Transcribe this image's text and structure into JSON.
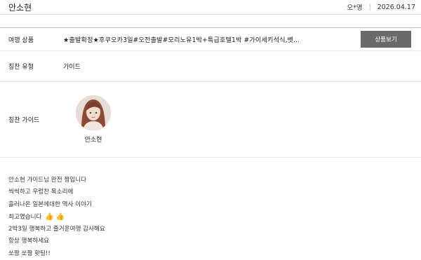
{
  "header": {
    "title": "안소현",
    "author": "오*영",
    "date": "2026.04.17"
  },
  "product": {
    "label": "여행 상품",
    "value": "★출발확정★후쿠오카3일#오전출발#모리노유1박+특급호텔1박 #가이세키석식,벳...",
    "button_label": "상품보기"
  },
  "praise_type": {
    "label": "칭찬 유형",
    "value": "가이드"
  },
  "praise_guide": {
    "label": "칭찬 가이드",
    "name": "안소현"
  },
  "review": {
    "lines": [
      "안소현 가이드님 완전 짱입니다",
      "씩씩하고 우렁찬 목소리에",
      "흘러나온 일본에대한 역사 이야기",
      "최고였습니다",
      "2박3일 행복하고 즐거운여행 감사해요",
      "항상 행복하세요",
      "쏘짱 쏘짱 홧팅!!"
    ],
    "emoji": "👍 👍"
  },
  "colors": {
    "button_bg": "#6a6a6a",
    "divider": "#e6e6e6"
  }
}
